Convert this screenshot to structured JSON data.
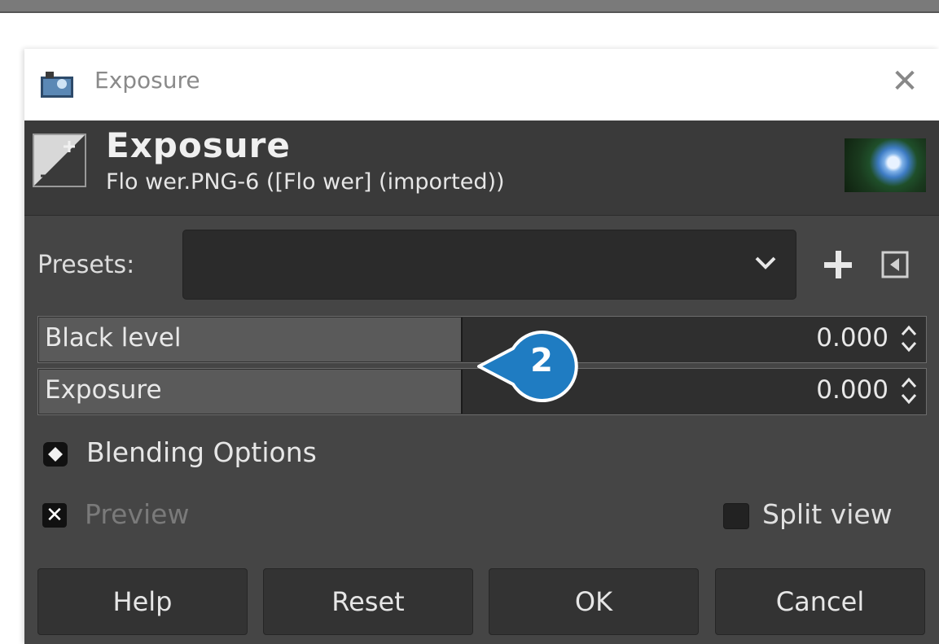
{
  "window": {
    "title": "Exposure",
    "close_glyph": "✕"
  },
  "header": {
    "title": "Exposure",
    "subtitle": "Flo wer.PNG-6 ([Flo wer] (imported))",
    "icon": "exposure-tool-icon",
    "thumbnail": "flower-thumbnail"
  },
  "presets": {
    "label": "Presets:",
    "value": ""
  },
  "sliders": [
    {
      "label": "Black level",
      "value": "0.000",
      "fill_fraction": 0.475
    },
    {
      "label": "Exposure",
      "value": "0.000",
      "fill_fraction": 0.475
    }
  ],
  "callout": {
    "number": "2",
    "color": "#1f7cc2"
  },
  "blending": {
    "label": "Blending Options"
  },
  "preview": {
    "label": "Preview",
    "checked": true,
    "check_glyph": "✕"
  },
  "split_view": {
    "label": "Split view",
    "checked": false
  },
  "buttons": {
    "help": "Help",
    "reset": "Reset",
    "ok": "OK",
    "cancel": "Cancel"
  },
  "colors": {
    "dialog_bg": "#454545",
    "header_bg": "#3a3a3a",
    "callout_blue": "#1f7cc2"
  }
}
